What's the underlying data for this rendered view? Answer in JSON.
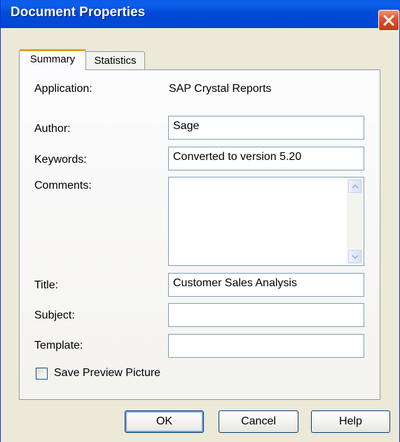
{
  "window": {
    "title": "Document Properties"
  },
  "tabs": [
    {
      "label": "Summary",
      "active": true
    },
    {
      "label": "Statistics",
      "active": false
    }
  ],
  "summary": {
    "application_label": "Application:",
    "application_value": "SAP Crystal Reports",
    "author_label": "Author:",
    "author_value": "Sage",
    "keywords_label": "Keywords:",
    "keywords_value": "Converted to version 5.20",
    "comments_label": "Comments:",
    "comments_value": "",
    "title_label": "Title:",
    "title_value": "Customer Sales Analysis",
    "subject_label": "Subject:",
    "subject_value": "",
    "template_label": "Template:",
    "template_value": "",
    "save_preview_label": "Save Preview Picture",
    "save_preview_checked": false
  },
  "buttons": {
    "ok": "OK",
    "cancel": "Cancel",
    "help": "Help"
  },
  "icons": {
    "close": "close-icon",
    "scroll_up": "scroll-up-icon",
    "scroll_down": "scroll-down-icon"
  },
  "colors": {
    "titlebar": "#0148d6",
    "dialog_bg": "#ece9d8",
    "tab_accent": "#e6a019",
    "close_button": "#e2542b"
  }
}
